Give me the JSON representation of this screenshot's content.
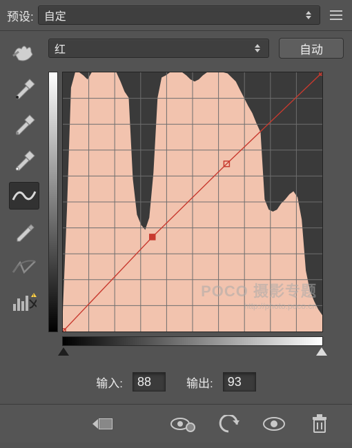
{
  "preset": {
    "label": "预设:",
    "value": "自定"
  },
  "channel": {
    "value": "红",
    "auto_label": "自动"
  },
  "io": {
    "input_label": "输入:",
    "output_label": "输出:",
    "input": "88",
    "output": "93"
  },
  "colors": {
    "curve": "#c83a2f",
    "histogram": "#f2c3ae",
    "panel": "#535353"
  },
  "tools": [
    {
      "name": "hand-icon"
    },
    {
      "name": "eyedropper-black-icon"
    },
    {
      "name": "eyedropper-gray-icon"
    },
    {
      "name": "eyedropper-white-icon"
    },
    {
      "name": "curve-mode-icon",
      "selected": true
    },
    {
      "name": "pencil-mode-icon"
    },
    {
      "name": "smooth-icon"
    },
    {
      "name": "histogram-clip-icon"
    }
  ],
  "watermark": {
    "line1": "POCO 摄影专题",
    "line2": "http://photo.poco.cn"
  },
  "footer_icons": [
    "grid-thumb-icon",
    "eye-mask-icon",
    "undo-icon",
    "eye-icon",
    "trash-icon"
  ],
  "chart_data": {
    "type": "line",
    "title": "",
    "xlabel": "输入",
    "ylabel": "输出",
    "xlim": [
      0,
      255
    ],
    "ylim": [
      0,
      255
    ],
    "series": [
      {
        "name": "curve",
        "x": [
          0,
          88,
          161,
          255
        ],
        "y": [
          0,
          93,
          165,
          255
        ]
      }
    ],
    "selected_point": {
      "x": 88,
      "y": 93
    },
    "histogram": {
      "bins": 64,
      "values": [
        20,
        120,
        240,
        255,
        255,
        252,
        248,
        255,
        255,
        255,
        255,
        255,
        255,
        255,
        246,
        236,
        230,
        150,
        115,
        105,
        100,
        112,
        156,
        230,
        250,
        252,
        255,
        255,
        255,
        255,
        252,
        248,
        246,
        248,
        252,
        255,
        255,
        255,
        255,
        255,
        254,
        250,
        246,
        238,
        230,
        222,
        215,
        205,
        196,
        130,
        120,
        118,
        120,
        126,
        130,
        135,
        138,
        132,
        110,
        60,
        40,
        30,
        22,
        16
      ]
    }
  }
}
